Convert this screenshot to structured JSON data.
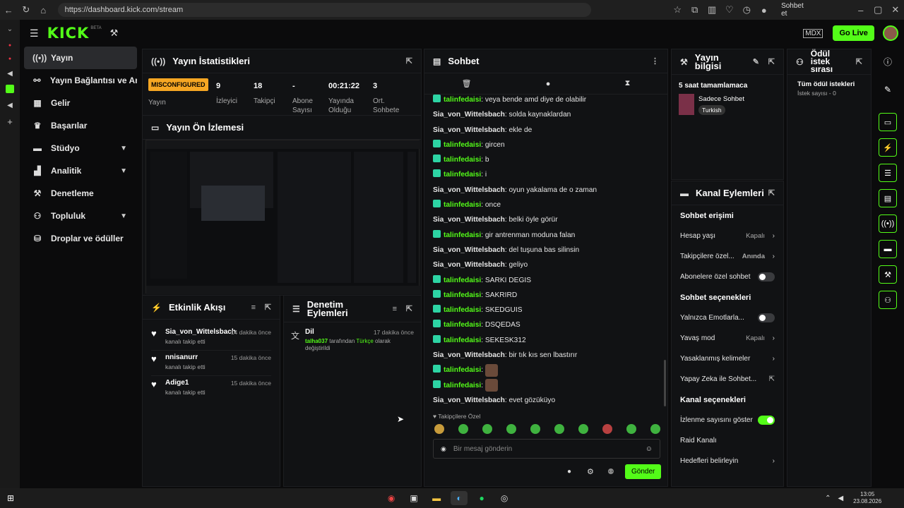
{
  "browser": {
    "url": "https://dashboard.kick.com/stream",
    "copilot_label": "Sohbet et"
  },
  "topbar": {
    "logo": "KICK",
    "logo_sup": "BETA",
    "go_live": "Go Live"
  },
  "sidebar": {
    "items": [
      {
        "label": "Yayın",
        "icon": "broadcast-icon"
      },
      {
        "label": "Yayın Bağlantısı ve Anahtarı",
        "icon": "link-icon"
      },
      {
        "label": "Gelir",
        "icon": "chart-icon"
      },
      {
        "label": "Başarılar",
        "icon": "trophy-icon"
      },
      {
        "label": "Stüdyo",
        "icon": "studio-icon"
      },
      {
        "label": "Analitik",
        "icon": "analytics-icon"
      },
      {
        "label": "Denetleme",
        "icon": "wrench-icon"
      },
      {
        "label": "Topluluk",
        "icon": "community-icon"
      },
      {
        "label": "Droplar ve ödüller",
        "icon": "gift-icon"
      }
    ]
  },
  "stats": {
    "title": "Yayın İstatistikleri",
    "status": "MISCONFIGURED",
    "status_label": "Yayın",
    "items": [
      {
        "value": "9",
        "label": "İzleyici"
      },
      {
        "value": "18",
        "label": "Takipçi"
      },
      {
        "value": "-",
        "label": "Abone Sayısı"
      },
      {
        "value": "00:21:22",
        "label": "Yayında Olduğu"
      },
      {
        "value": "3",
        "label": "Ort. Sohbete"
      }
    ]
  },
  "preview": {
    "title": "Yayın Ön İzlemesi"
  },
  "activity": {
    "title": "Etkinlik Akışı",
    "items": [
      {
        "user": "Sia_von_Wittelsbach",
        "time": "14 dakika önce",
        "text": "kanalı takip etti"
      },
      {
        "user": "nnisanurr",
        "time": "15 dakika önce",
        "text": "kanalı takip etti"
      },
      {
        "user": "Adige1",
        "time": "15 dakika önce",
        "text": "kanalı takip etti"
      }
    ]
  },
  "moderation": {
    "title": "Denetim Eylemleri",
    "item_title": "Dil",
    "item_time": "17 dakika önce",
    "item_user": "talha037",
    "item_mid": " tarafından ",
    "item_lang": "Türkçe",
    "item_end": " olarak değiştirildi"
  },
  "chat": {
    "title": "Sohbet",
    "messages": [
      {
        "user": "talinfedaisi",
        "text": "veya bende amd diye de olabilir",
        "badge": true
      },
      {
        "user": "Sia_von_Wittelsbach",
        "text": "solda kaynaklardan",
        "badge": false
      },
      {
        "user": "Sia_von_Wittelsbach",
        "text": "ekle de",
        "badge": false
      },
      {
        "user": "talinfedaisi",
        "text": "gircen",
        "badge": true
      },
      {
        "user": "talinfedaisi",
        "text": "b",
        "badge": true
      },
      {
        "user": "talinfedaisi",
        "text": "i",
        "badge": true
      },
      {
        "user": "Sia_von_Wittelsbach",
        "text": "oyun yakalama de o zaman",
        "badge": false
      },
      {
        "user": "talinfedaisi",
        "text": "once",
        "badge": true
      },
      {
        "user": "Sia_von_Wittelsbach",
        "text": "belki öyle görür",
        "badge": false
      },
      {
        "user": "talinfedaisi",
        "text": "gir antrenman moduna falan",
        "badge": true
      },
      {
        "user": "Sia_von_Wittelsbach",
        "text": "del tuşuna bas silinsin",
        "badge": false
      },
      {
        "user": "Sia_von_Wittelsbach",
        "text": "geliyo",
        "badge": false
      },
      {
        "user": "talinfedaisi",
        "text": "SARKI DEGIS",
        "badge": true
      },
      {
        "user": "talinfedaisi",
        "text": "SAKRIRD",
        "badge": true
      },
      {
        "user": "talinfedaisi",
        "text": "SKEDGUIS",
        "badge": true
      },
      {
        "user": "talinfedaisi",
        "text": "DSQEDAS",
        "badge": true
      },
      {
        "user": "talinfedaisi",
        "text": "SEKESK312",
        "badge": true
      },
      {
        "user": "Sia_von_Wittelsbach",
        "text": "bir tık kıs sen lbastırır",
        "badge": false
      },
      {
        "user": "talinfedaisi",
        "text": "",
        "badge": true,
        "emote": true
      },
      {
        "user": "talinfedaisi",
        "text": "",
        "badge": true,
        "emote": true
      },
      {
        "user": "Sia_von_Wittelsbach",
        "text": "evet gözüküyo",
        "badge": false
      }
    ],
    "followers_only": "Takipçilere Özel",
    "placeholder": "Bir mesaj gönderin",
    "send": "Gönder"
  },
  "stream_info": {
    "title": "Yayın bilgisi",
    "subtitle": "5 saat tamamlamaca",
    "category": "Sadece Sohbet",
    "language": "Turkish"
  },
  "rewards": {
    "title": "Ödül istek sırası",
    "all": "Tüm ödül istekleri",
    "count": "İstek sayısı - 0"
  },
  "channel_actions": {
    "title": "Kanal Eylemleri",
    "chat_access": "Sohbet erişimi",
    "account_age": "Hesap yaşı",
    "account_age_val": "Kapalı",
    "followers_only": "Takipçilere özel...",
    "followers_only_val": "Anında",
    "subscribers_only": "Abonelere özel sohbet",
    "chat_options": "Sohbet seçenekleri",
    "emotes_only": "Yalnızca Emotlarla...",
    "slow_mode": "Yavaş mod",
    "slow_mode_val": "Kapalı",
    "banned_words": "Yasaklanmış kelimeler",
    "ai_chat": "Yapay Zeka ile Sohbet...",
    "channel_options": "Kanal seçenekleri",
    "show_viewers": "İzlenme sayısını göster",
    "raid": "Raid Kanalı",
    "goals": "Hedefleri belirleyin"
  },
  "taskbar": {
    "time": "13:05",
    "date": "23.08.2026"
  },
  "colors": {
    "accent": "#53fc18",
    "panel": "#111214",
    "warning": "#f5a623"
  }
}
